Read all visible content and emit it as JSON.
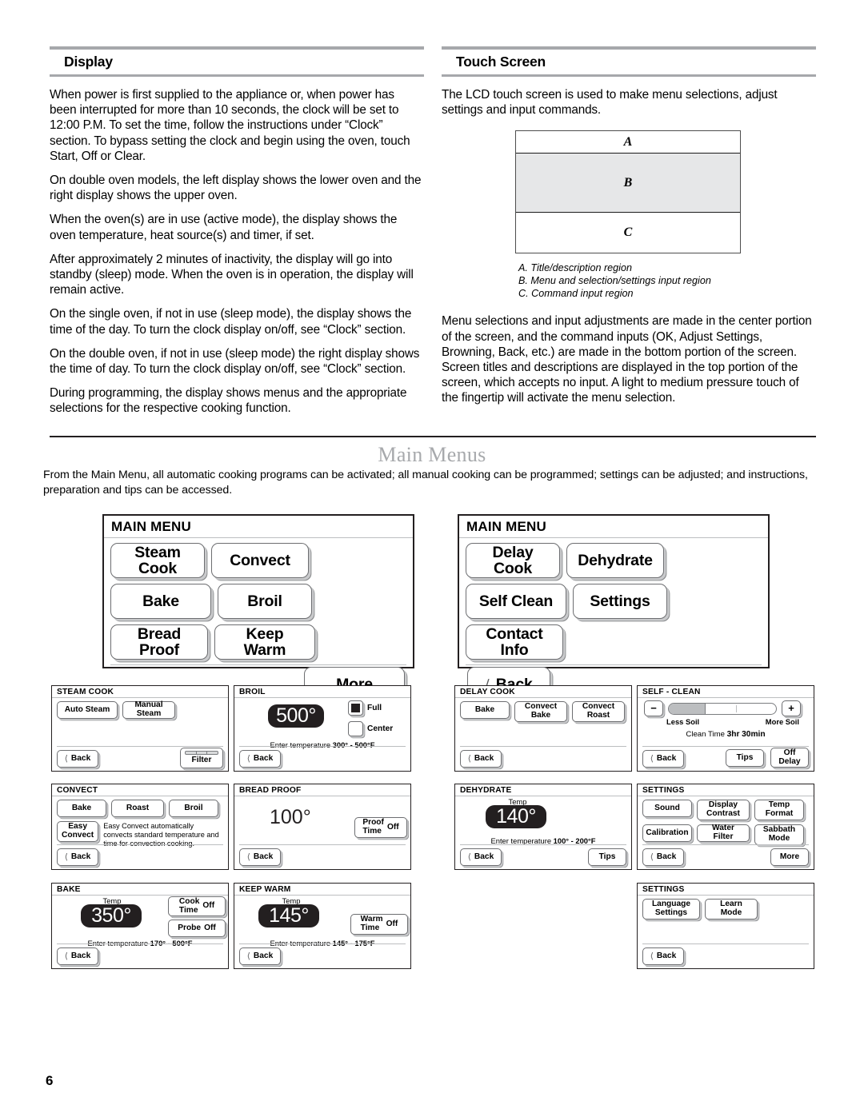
{
  "page_number": "6",
  "left_column": {
    "section_title": "Display",
    "paragraphs": [
      "When power is first supplied to the appliance or, when power has been interrupted for more than 10 seconds, the clock will be set to 12:00 P.M. To set the time, follow the instructions under “Clock” section. To bypass setting the clock and begin using the oven, touch Start, Off or Clear.",
      "On double oven models, the left display shows the lower oven and the right display shows the upper oven.",
      "When the oven(s) are in use (active mode), the display shows the oven temperature, heat source(s) and timer, if set.",
      "After approximately 2 minutes of inactivity, the display will go into standby (sleep) mode. When the oven is in operation, the display will remain active.",
      "On the single oven, if not in use (sleep mode), the display shows the time of the day. To turn the clock display on/off, see “Clock” section.",
      "On the double oven, if not in use (sleep mode) the right display shows the time of day. To turn the clock display on/off, see “Clock” section.",
      "During programming, the display shows menus and the appropriate selections for the respective cooking function."
    ]
  },
  "right_column": {
    "section_title": "Touch Screen",
    "intro": "The LCD touch screen is used to make menu selections, adjust settings and input commands.",
    "diagram": {
      "region_a": "A",
      "region_b": "B",
      "region_c": "C"
    },
    "legend": [
      "A. Title/description region",
      "B. Menu and selection/settings input region",
      "C. Command input region"
    ],
    "paragraph": "Menu selections and input adjustments are made in the center portion of the screen, and the command inputs (OK, Adjust Settings, Browning, Back, etc.) are made in the bottom portion of the screen. Screen titles and descriptions are displayed in the top portion of the screen, which accepts no input. A light to medium pressure touch of the fingertip will activate the menu selection."
  },
  "main_menus": {
    "heading": "Main Menus",
    "intro": "From the Main Menu, all automatic cooking programs can be activated; all manual cooking can be programmed; settings can be adjusted; and instructions, preparation and tips can be accessed.",
    "screen_page1": {
      "title": "MAIN MENU",
      "buttons": [
        "Steam Cook",
        "Convect",
        "Bake",
        "Broil",
        "Bread Proof",
        "Keep Warm"
      ],
      "footer_button": "More"
    },
    "screen_page2": {
      "title": "MAIN MENU",
      "buttons": [
        "Delay Cook",
        "Dehydrate",
        "Self Clean",
        "Settings",
        "Contact Info"
      ],
      "footer_button": "Back",
      "footer_icon": "chevron-left-icon"
    }
  },
  "sub_screens": {
    "steam_cook": {
      "title": "STEAM COOK",
      "buttons": [
        "Auto Steam",
        "Manual Steam"
      ],
      "back": "Back",
      "filter": "Filter"
    },
    "broil": {
      "title": "BROIL",
      "temperature": "500°",
      "options": [
        "Full",
        "Center"
      ],
      "checked_option": "Full",
      "hint_prefix": "Enter temperature ",
      "hint_range": "300° - 500°F",
      "back": "Back"
    },
    "convect": {
      "title": "CONVECT",
      "buttons": [
        "Bake",
        "Roast",
        "Broil",
        "Easy Convect"
      ],
      "description": "Easy Convect automatically convects standard temperature and time for convection cooking.",
      "back": "Back"
    },
    "bread_proof": {
      "title": "BREAD PROOF",
      "temperature": "100°",
      "proof_time_label": "Proof Time",
      "proof_time_value": "Off",
      "back": "Back"
    },
    "bake": {
      "title": "BAKE",
      "temp_label": "Temp",
      "temperature": "350°",
      "cook_time_label": "Cook Time",
      "cook_time_value": "Off",
      "probe_label": "Probe",
      "probe_value": "Off",
      "hint_prefix": "Enter temperature ",
      "hint_range": "170° - 500°F",
      "back": "Back"
    },
    "keep_warm": {
      "title": "KEEP WARM",
      "temp_label": "Temp",
      "temperature": "145°",
      "warm_time_label": "Warm Time",
      "warm_time_value": "Off",
      "hint_prefix": "Enter temperature ",
      "hint_range": "145° - 175°F",
      "back": "Back"
    },
    "delay_cook": {
      "title": "DELAY COOK",
      "buttons": [
        "Bake",
        "Convect Bake",
        "Convect Roast"
      ],
      "back": "Back"
    },
    "self_clean": {
      "title": "SELF - CLEAN",
      "minus": "−",
      "plus": "+",
      "less_soil": "Less Soil",
      "more_soil": "More Soil",
      "clean_time_label": "Clean Time",
      "clean_time_hours": "3hr",
      "clean_time_minutes": "30min",
      "back": "Back",
      "tips": "Tips",
      "off_delay_line1": "Off",
      "off_delay_line2": "Delay"
    },
    "dehydrate": {
      "title": "DEHYDRATE",
      "temp_label": "Temp",
      "temperature": "140°",
      "hint_prefix": "Enter temperature ",
      "hint_range": "100° - 200°F",
      "back": "Back",
      "tips": "Tips"
    },
    "settings_1": {
      "title": "SETTINGS",
      "buttons": [
        "Sound",
        "Display Contrast",
        "Temp Format",
        "Calibration",
        "Water Filter",
        "Sabbath Mode"
      ],
      "back": "Back",
      "more": "More"
    },
    "settings_2": {
      "title": "SETTINGS",
      "buttons": [
        "Language Settings",
        "Learn Mode"
      ],
      "back": "Back"
    }
  }
}
